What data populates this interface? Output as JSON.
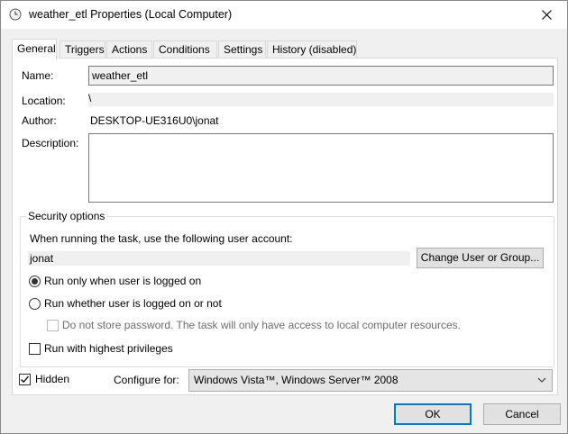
{
  "window": {
    "title": "weather_etl Properties (Local Computer)"
  },
  "tabs": [
    {
      "label": "General",
      "active": true
    },
    {
      "label": "Triggers"
    },
    {
      "label": "Actions"
    },
    {
      "label": "Conditions"
    },
    {
      "label": "Settings"
    },
    {
      "label": "History (disabled)"
    }
  ],
  "general": {
    "name_label": "Name:",
    "name_value": "weather_etl",
    "location_label": "Location:",
    "location_value": "\\",
    "author_label": "Author:",
    "author_value": "DESKTOP-UE316U0\\jonat",
    "description_label": "Description:",
    "description_value": ""
  },
  "security": {
    "title": "Security options",
    "account_prompt": "When running the task, use the following user account:",
    "account_value": "jonat",
    "change_button": "Change User or Group...",
    "radio_logged_on": "Run only when user is logged on",
    "radio_logged_on_checked": true,
    "radio_whether": "Run whether user is logged on or not",
    "radio_whether_checked": false,
    "no_store_password": "Do not store password.  The task will only have access to local computer resources.",
    "no_store_password_checked": false,
    "highest_privileges": "Run with highest privileges",
    "highest_privileges_checked": false
  },
  "footer_options": {
    "hidden_label": "Hidden",
    "hidden_checked": true,
    "configure_label": "Configure for:",
    "configure_value": "Windows Vista™, Windows Server™ 2008"
  },
  "buttons": {
    "ok": "OK",
    "cancel": "Cancel"
  },
  "icons": {
    "title": "clock-icon",
    "close": "close-icon",
    "dropdown": "chevron-down-icon",
    "check": "checkmark-icon"
  },
  "colors": {
    "default_button_border": "#0078d7",
    "panel_bg": "#ffffff",
    "window_bg": "#f0f0f0"
  }
}
